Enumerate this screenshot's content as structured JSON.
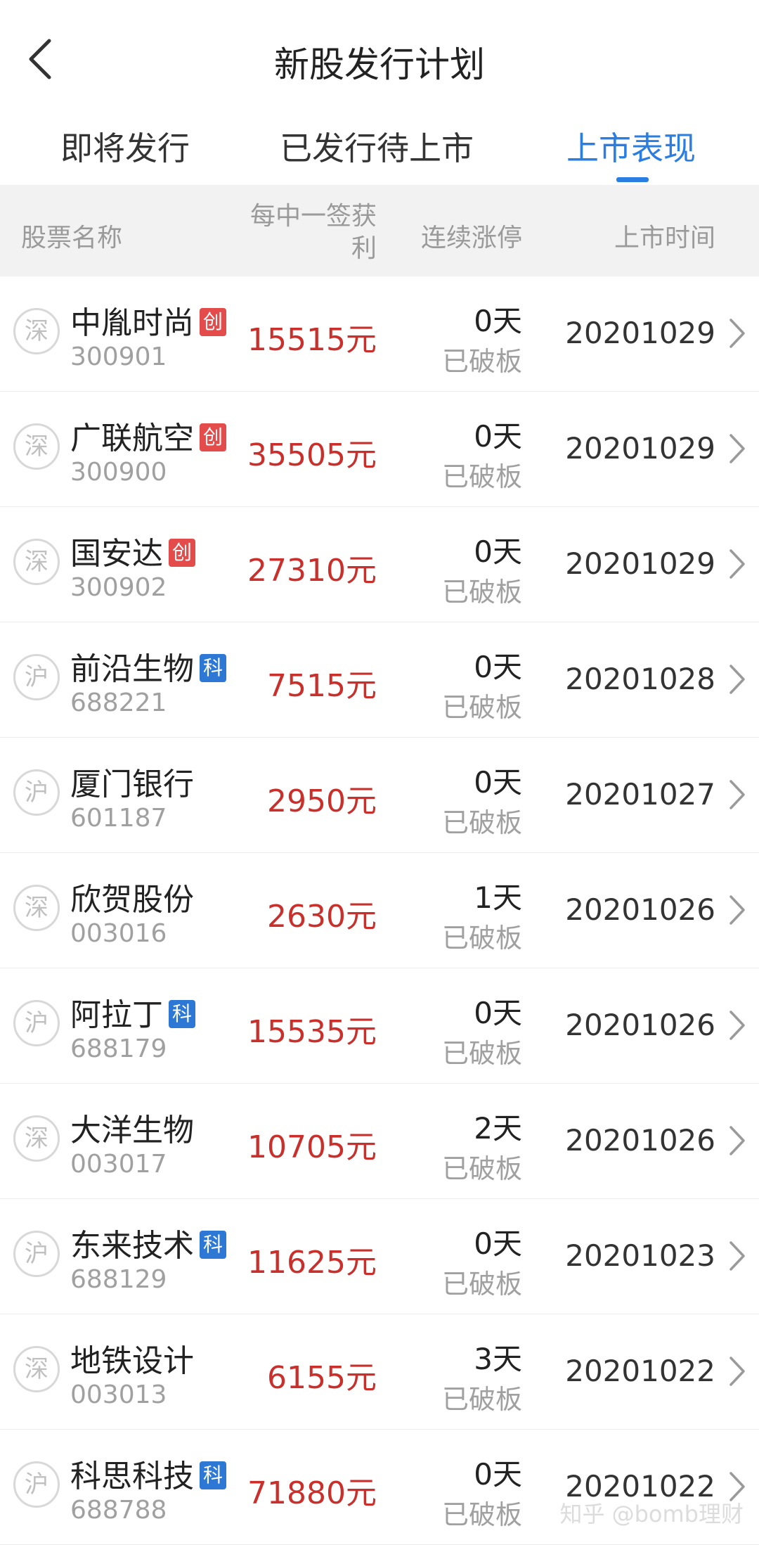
{
  "header": {
    "title": "新股发行计划"
  },
  "tabs": [
    {
      "label": "即将发行"
    },
    {
      "label": "已发行待上市"
    },
    {
      "label": "上市表现"
    }
  ],
  "columns": {
    "name": "股票名称",
    "profit_line1": "每中一签获",
    "profit_line2": "利",
    "limit": "连续涨停",
    "date": "上市时间"
  },
  "rows": [
    {
      "exchange": "深",
      "name": "中胤时尚",
      "tag": "创",
      "tag_type": "chuang",
      "code": "300901",
      "profit": "15515元",
      "days": "0天",
      "status": "已破板",
      "date": "20201029"
    },
    {
      "exchange": "深",
      "name": "广联航空",
      "tag": "创",
      "tag_type": "chuang",
      "code": "300900",
      "profit": "35505元",
      "days": "0天",
      "status": "已破板",
      "date": "20201029"
    },
    {
      "exchange": "深",
      "name": "国安达",
      "tag": "创",
      "tag_type": "chuang",
      "code": "300902",
      "profit": "27310元",
      "days": "0天",
      "status": "已破板",
      "date": "20201029"
    },
    {
      "exchange": "沪",
      "name": "前沿生物",
      "tag": "科",
      "tag_type": "ke",
      "code": "688221",
      "profit": "7515元",
      "days": "0天",
      "status": "已破板",
      "date": "20201028"
    },
    {
      "exchange": "沪",
      "name": "厦门银行",
      "tag": "",
      "tag_type": "",
      "code": "601187",
      "profit": "2950元",
      "days": "0天",
      "status": "已破板",
      "date": "20201027"
    },
    {
      "exchange": "深",
      "name": "欣贺股份",
      "tag": "",
      "tag_type": "",
      "code": "003016",
      "profit": "2630元",
      "days": "1天",
      "status": "已破板",
      "date": "20201026"
    },
    {
      "exchange": "沪",
      "name": "阿拉丁",
      "tag": "科",
      "tag_type": "ke",
      "code": "688179",
      "profit": "15535元",
      "days": "0天",
      "status": "已破板",
      "date": "20201026"
    },
    {
      "exchange": "深",
      "name": "大洋生物",
      "tag": "",
      "tag_type": "",
      "code": "003017",
      "profit": "10705元",
      "days": "2天",
      "status": "已破板",
      "date": "20201026"
    },
    {
      "exchange": "沪",
      "name": "东来技术",
      "tag": "科",
      "tag_type": "ke",
      "code": "688129",
      "profit": "11625元",
      "days": "0天",
      "status": "已破板",
      "date": "20201023"
    },
    {
      "exchange": "深",
      "name": "地铁设计",
      "tag": "",
      "tag_type": "",
      "code": "003013",
      "profit": "6155元",
      "days": "3天",
      "status": "已破板",
      "date": "20201022"
    },
    {
      "exchange": "沪",
      "name": "科思科技",
      "tag": "科",
      "tag_type": "ke",
      "code": "688788",
      "profit": "71880元",
      "days": "0天",
      "status": "已破板",
      "date": "20201022"
    }
  ],
  "watermark": "知乎 @bomb理财",
  "colors": {
    "accent": "#2a7de1",
    "profit": "#c9302c",
    "tag_chuang": "#e44b4b",
    "tag_ke": "#2c78d4"
  }
}
